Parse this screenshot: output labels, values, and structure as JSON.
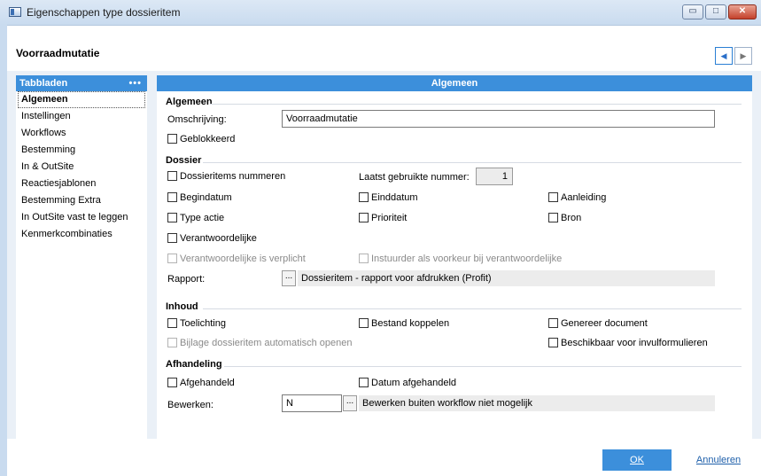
{
  "window": {
    "title": "Eigenschappen type dossieritem",
    "min_glyph": "▭",
    "max_glyph": "□",
    "close_glyph": "✕"
  },
  "header": {
    "title": "Voorraadmutatie",
    "prev_glyph": "◀",
    "next_glyph": "▶"
  },
  "sidebar": {
    "title": "Tabbladen",
    "dots": "•••",
    "items": [
      {
        "label": "Algemeen"
      },
      {
        "label": "Instellingen"
      },
      {
        "label": "Workflows"
      },
      {
        "label": "Bestemming"
      },
      {
        "label": "In & OutSite"
      },
      {
        "label": "Reactiesjablonen"
      },
      {
        "label": "Bestemming Extra"
      },
      {
        "label": "In OutSite vast te leggen"
      },
      {
        "label": "Kenmerkcombinaties"
      }
    ]
  },
  "main": {
    "title": "Algemeen",
    "algemeen": {
      "section": "Algemeen",
      "omschrijving_label": "Omschrijving:",
      "omschrijving_value": "Voorraadmutatie",
      "geblokkeerd": "Geblokkeerd"
    },
    "dossier": {
      "section": "Dossier",
      "nummeren": "Dossieritems nummeren",
      "laatst_label": "Laatst gebruikte nummer:",
      "laatst_value": "1",
      "begindatum": "Begindatum",
      "einddatum": "Einddatum",
      "aanleiding": "Aanleiding",
      "type_actie": "Type actie",
      "prioriteit": "Prioriteit",
      "bron": "Bron",
      "verantwoordelijke": "Verantwoordelijke",
      "verplicht": "Verantwoordelijke is verplicht",
      "instuurder": "Instuurder als voorkeur bij verantwoordelijke",
      "rapport_label": "Rapport:",
      "rapport_btn": "...",
      "rapport_value": "Dossieritem - rapport voor afdrukken (Profit)"
    },
    "inhoud": {
      "section": "Inhoud",
      "toelichting": "Toelichting",
      "bestand": "Bestand koppelen",
      "genereer": "Genereer document",
      "bijlage": "Bijlage dossieritem automatisch openen",
      "beschikbaar": "Beschikbaar voor invulformulieren"
    },
    "afhandeling": {
      "section": "Afhandeling",
      "afgehandeld": "Afgehandeld",
      "datum": "Datum afgehandeld",
      "bewerken_label": "Bewerken:",
      "bewerken_value": "N",
      "bewerken_btn": "...",
      "bewerken_desc": "Bewerken buiten workflow niet mogelijk"
    }
  },
  "footer": {
    "ok": "OK",
    "cancel": "Annuleren"
  }
}
